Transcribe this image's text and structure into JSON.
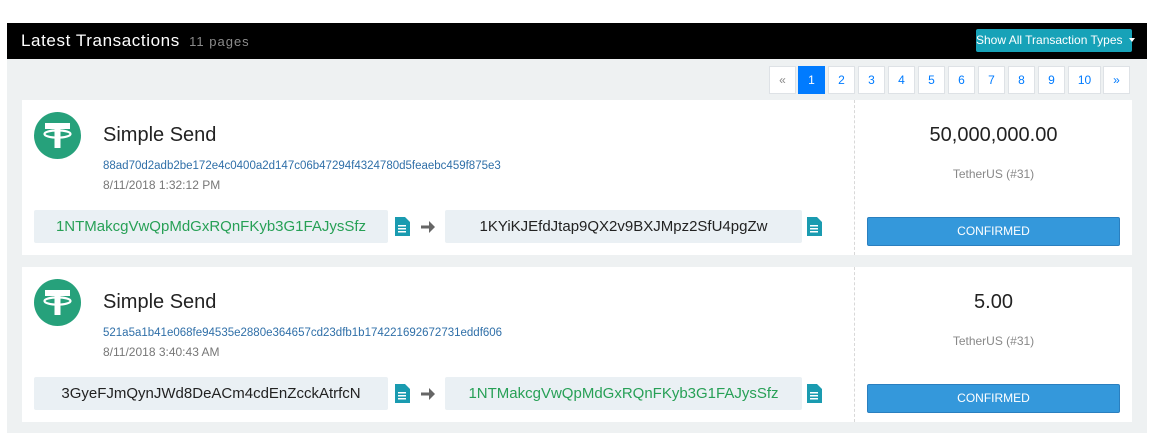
{
  "header": {
    "title": "Latest Transactions",
    "subtitle": "11 pages",
    "filter_button": "Show All Transaction Types"
  },
  "pagination": {
    "prev": "«",
    "next": "»",
    "pages": [
      "1",
      "2",
      "3",
      "4",
      "5",
      "6",
      "7",
      "8",
      "9",
      "10"
    ],
    "active_page": "1"
  },
  "transactions": [
    {
      "type": "Simple Send",
      "hash": "88ad70d2adb2be172e4c0400a2d147c06b47294f4324780d5feaebc459f875e3",
      "time": "8/11/2018 1:32:12 PM",
      "from": "1NTMakcgVwQpMdGxRQnFKyb3G1FAJysSfz",
      "to": "1KYiKJEfdJtap9QX2v9BXJMpz2SfU4pgZw",
      "amount": "50,000,000.00",
      "currency": "TetherUS (#31)",
      "status": "CONFIRMED"
    },
    {
      "type": "Simple Send",
      "hash": "521a5a1b41e068fe94535e2880e364657cd23dfb1b174221692672731eddf606",
      "time": "8/11/2018 3:40:43 AM",
      "from": "3GyeFJmQynJWd8DeACm4cdEnZcckAtrfcN",
      "to": "1NTMakcgVwQpMdGxRQnFKyb3G1FAJysSfz",
      "amount": "5.00",
      "currency": "TetherUS (#31)",
      "status": "CONFIRMED"
    }
  ],
  "icons": {
    "coin": "tether-icon",
    "copy": "copy-icon",
    "arrow": "arrow-right-icon"
  },
  "colors": {
    "header_bg": "#000000",
    "filter_button": "#17a2b8",
    "page_active": "#007bff",
    "tether_green": "#26a17b",
    "address_green": "#27a056",
    "hash_link": "#2f6fa8",
    "confirmed": "#3498db",
    "copy_icon": "#1a9bb0"
  }
}
